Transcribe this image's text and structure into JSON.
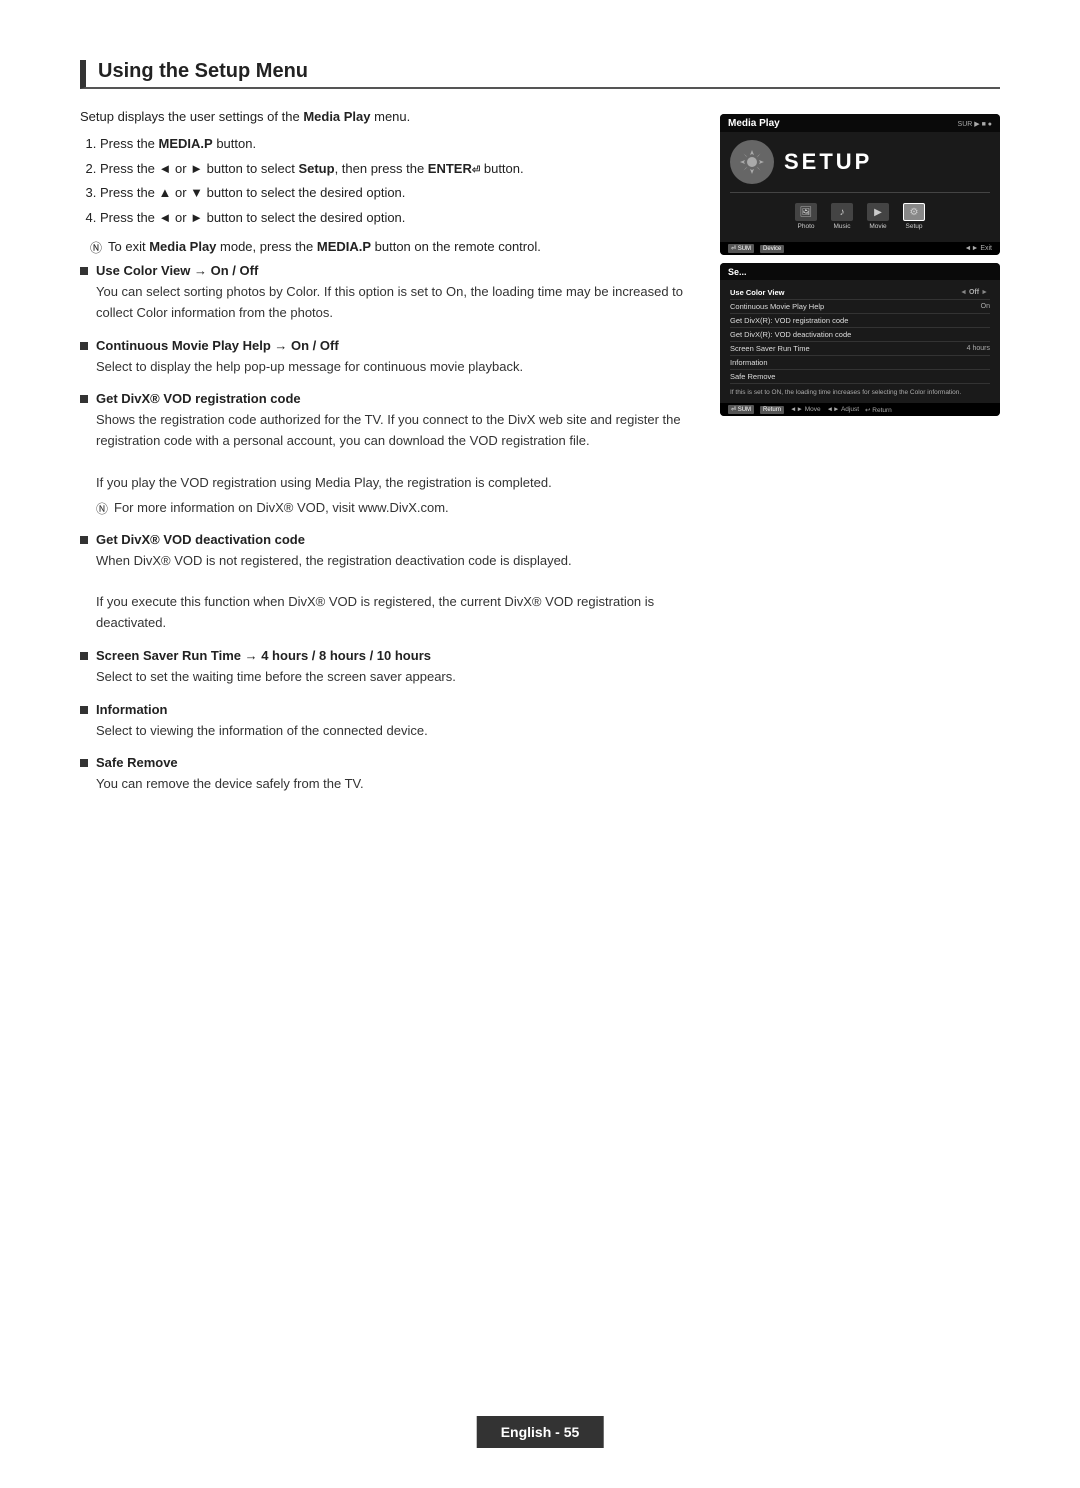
{
  "page": {
    "title": "Using the Setup Menu",
    "footer": "English - 55"
  },
  "intro": {
    "text": "Setup displays the user settings of the ",
    "bold": "Media Play",
    "text2": " menu."
  },
  "steps": [
    {
      "num": "1.",
      "text": "Press the ",
      "bold": "MEDIA.P",
      "text2": " button."
    },
    {
      "num": "2.",
      "text": "Press the ◄ or ► button to select ",
      "bold": "Setup",
      "text2": ", then press the ",
      "bold2": "ENTER",
      "text3": " button."
    },
    {
      "num": "3.",
      "text": "Press the ▲ or ▼ button to select the desired option."
    },
    {
      "num": "4.",
      "text": "Press the ◄ or ► button to select the desired option."
    }
  ],
  "note": {
    "symbol": "N",
    "text": "To exit ",
    "bold": "Media Play",
    "text2": " mode, press the ",
    "bold2": "MEDIA.P",
    "text3": " button on the remote control."
  },
  "sections": [
    {
      "id": "use-color-view",
      "title": "Use Color View → On / Off",
      "body": "You can select sorting photos by Color. If this option is set to On, the loading time may be increased to collect Color information from the photos."
    },
    {
      "id": "continuous-movie",
      "title": "Continuous Movie Play Help → On / Off",
      "body": "Select to display the help pop-up message for continuous movie playback."
    },
    {
      "id": "divx-registration",
      "title": "Get DivX® VOD registration code",
      "body1": "Shows the registration code authorized for the TV. If you connect to the DivX web site and register the registration code with a personal account, you can download the VOD registration file.",
      "body2": "If you play the VOD registration using Media Play, the registration is completed.",
      "note_symbol": "N",
      "note_text": "For more information on DivX® VOD, visit www.DivX.com."
    },
    {
      "id": "divx-deactivation",
      "title": "Get DivX® VOD deactivation code",
      "body1": "When DivX® VOD is not registered, the registration deactivation code is displayed.",
      "body2": "If you execute this function when DivX® VOD is registered, the current DivX® VOD registration is deactivated."
    },
    {
      "id": "screen-saver",
      "title": "Screen Saver Run Time → 4 hours / 8 hours / 10 hours",
      "body": "Select to set the waiting time before the screen saver appears."
    },
    {
      "id": "information",
      "title": "Information",
      "body": "Select to viewing the information of the connected device."
    },
    {
      "id": "safe-remove",
      "title": "Safe Remove",
      "body": "You can remove the device safely from the TV."
    }
  ],
  "screenshot1": {
    "title": "Media Play",
    "sub": "SUR ▶ ■ ●",
    "setup_label": "SETUP",
    "icons": [
      {
        "label": "Photo",
        "symbol": "🖼"
      },
      {
        "label": "Music",
        "symbol": "♪"
      },
      {
        "label": "Movie",
        "symbol": "🎬"
      },
      {
        "label": "Setup",
        "symbol": "⚙"
      }
    ],
    "toolbar": [
      {
        "btn": "⏎ SUM",
        "label": ""
      },
      {
        "btn": "Device",
        "label": ""
      },
      {
        "btn": "◄► Exit",
        "label": ""
      }
    ]
  },
  "screenshot2": {
    "title": "Se...",
    "rows": [
      {
        "label": "Use Color View",
        "left": "◄",
        "value": "Off",
        "right": "►"
      },
      {
        "label": "Continuous Movie Play Help",
        "value": "On"
      },
      {
        "label": "Get DivX® VOD registration code",
        "value": ""
      },
      {
        "label": "Get DivX(R): VOD deactivation code",
        "value": ""
      },
      {
        "label": "Screen Saver Run Time",
        "value": "4 hours"
      },
      {
        "label": "Information",
        "value": ""
      },
      {
        "label": "Safe Remove",
        "value": ""
      }
    ],
    "note": "If this is set to ON, the loading time increases for selecting the Color information.",
    "toolbar": [
      {
        "btn": "⏎ SUM",
        "label": ""
      },
      {
        "btn": "Return",
        "label": ""
      },
      {
        "btn": "◄► Move",
        "label": ""
      },
      {
        "btn": "◄► Adjust",
        "label": ""
      },
      {
        "btn": "↩ Return",
        "label": ""
      }
    ]
  }
}
